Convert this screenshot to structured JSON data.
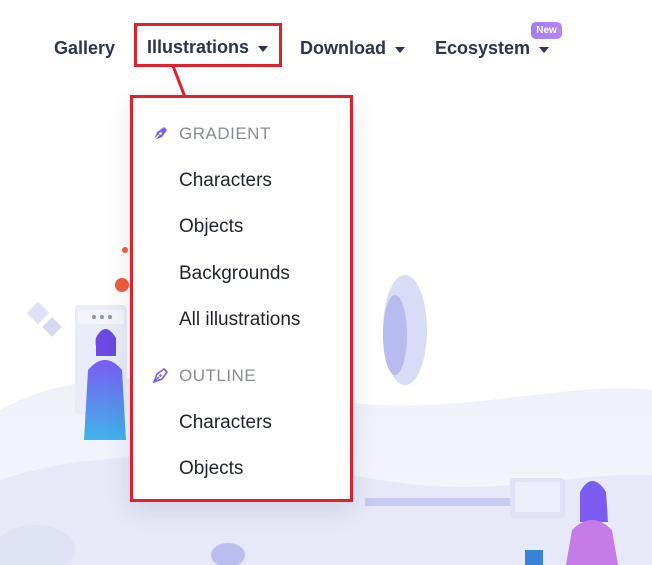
{
  "nav": {
    "gallery": "Gallery",
    "illustrations": "Illustrations",
    "download": "Download",
    "ecosystem": "Ecosystem",
    "new_badge": "New"
  },
  "dropdown": {
    "sections": [
      {
        "header": "GRADIENT",
        "icon": "pen-nib-gradient-icon",
        "items": [
          "Characters",
          "Objects",
          "Backgrounds",
          "All illustrations"
        ]
      },
      {
        "header": "OUTLINE",
        "icon": "pen-nib-outline-icon",
        "items": [
          "Characters",
          "Objects"
        ]
      }
    ]
  },
  "colors": {
    "nav_text": "#2b3450",
    "highlight": "#e1202c",
    "badge": "#a77ff5",
    "accent_purple": "#7b5cf0"
  }
}
